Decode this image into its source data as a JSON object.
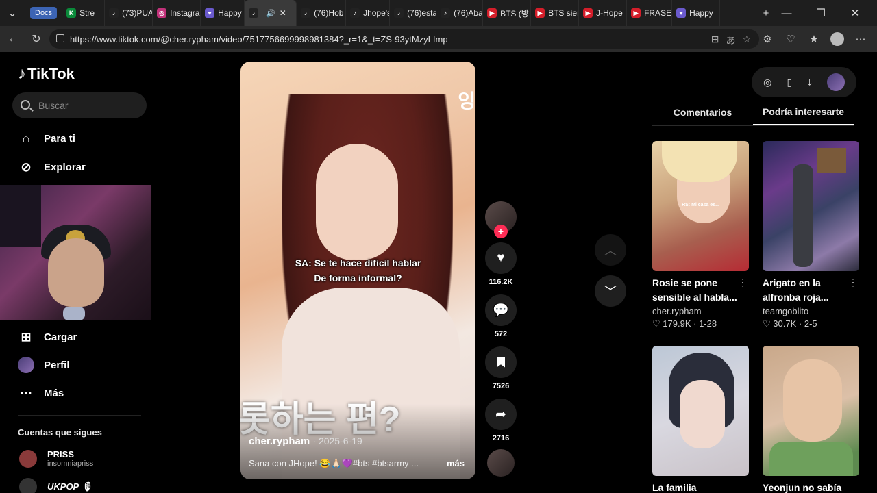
{
  "browser": {
    "docs_label": "Docs",
    "tabs": [
      {
        "label": "Stre",
        "icon": "K"
      },
      {
        "label": "(73)PUA",
        "icon": "♪"
      },
      {
        "label": "Instagra",
        "icon": "◎"
      },
      {
        "label": "Happy",
        "icon": "♥"
      },
      {
        "label": "",
        "icon": "♪",
        "active": true
      },
      {
        "label": "(76)Hob",
        "icon": "♪"
      },
      {
        "label": "Jhope's",
        "icon": "♪"
      },
      {
        "label": "(76)esta",
        "icon": "♪"
      },
      {
        "label": "(76)Aba",
        "icon": "♪"
      },
      {
        "label": "BTS (방",
        "icon": "▶"
      },
      {
        "label": "BTS sier",
        "icon": "▶"
      },
      {
        "label": "J-Hope",
        "icon": "▶"
      },
      {
        "label": "FRASES",
        "icon": "▶"
      },
      {
        "label": "Happy",
        "icon": "♥"
      }
    ],
    "url": "https://www.tiktok.com/@cher.rypham/video/7517756699998981384?_r=1&_t=ZS-93ytMzyLImp"
  },
  "sidebar": {
    "logo": "TikTok",
    "search_placeholder": "Buscar",
    "nav": {
      "for_you": "Para ti",
      "explore": "Explorar",
      "upload": "Cargar",
      "profile": "Perfil",
      "more": "Más"
    },
    "following_title": "Cuentas que sigues",
    "following": [
      {
        "name": "PRISS",
        "handle": "insomniapriss"
      },
      {
        "name": "UKPOP 🎙",
        "handle": ""
      }
    ]
  },
  "video": {
    "watermark": "잉",
    "subtitle_line1": "SA: Se te hace dificil hablar",
    "subtitle_line2": "De forma informal?",
    "korean_caption": "롯하는 편?",
    "author": "cher.rypham",
    "date": "2025-6-19",
    "description": "Sana con JHope! 😂🙏🏻💜#bts #btsarmy ...",
    "more_label": "más"
  },
  "actions": {
    "likes": "116.2K",
    "comments": "572",
    "saves": "7526",
    "shares": "2716"
  },
  "right_panel": {
    "tab_comments": "Comentarios",
    "tab_suggested": "Podría interesarte",
    "cards": [
      {
        "title": "Rosie se pone sensible al habla...",
        "user": "cher.rypham",
        "likes": "179.9K",
        "date": "1-28",
        "overlay": "RS: Mi casa es..."
      },
      {
        "title": "Arigato en la alfronba roja...",
        "user": "teamgoblito",
        "likes": "30.7K",
        "date": "2-5",
        "overlay": ""
      },
      {
        "title": "La familia",
        "user": "",
        "likes": "",
        "date": "",
        "overlay": ""
      },
      {
        "title": "Yeonjun no sabía",
        "user": "",
        "likes": "",
        "date": "",
        "overlay": ""
      }
    ]
  },
  "colors": {
    "accent": "#fe2c55",
    "bg": "#000000",
    "panel": "#1f1f1f"
  }
}
